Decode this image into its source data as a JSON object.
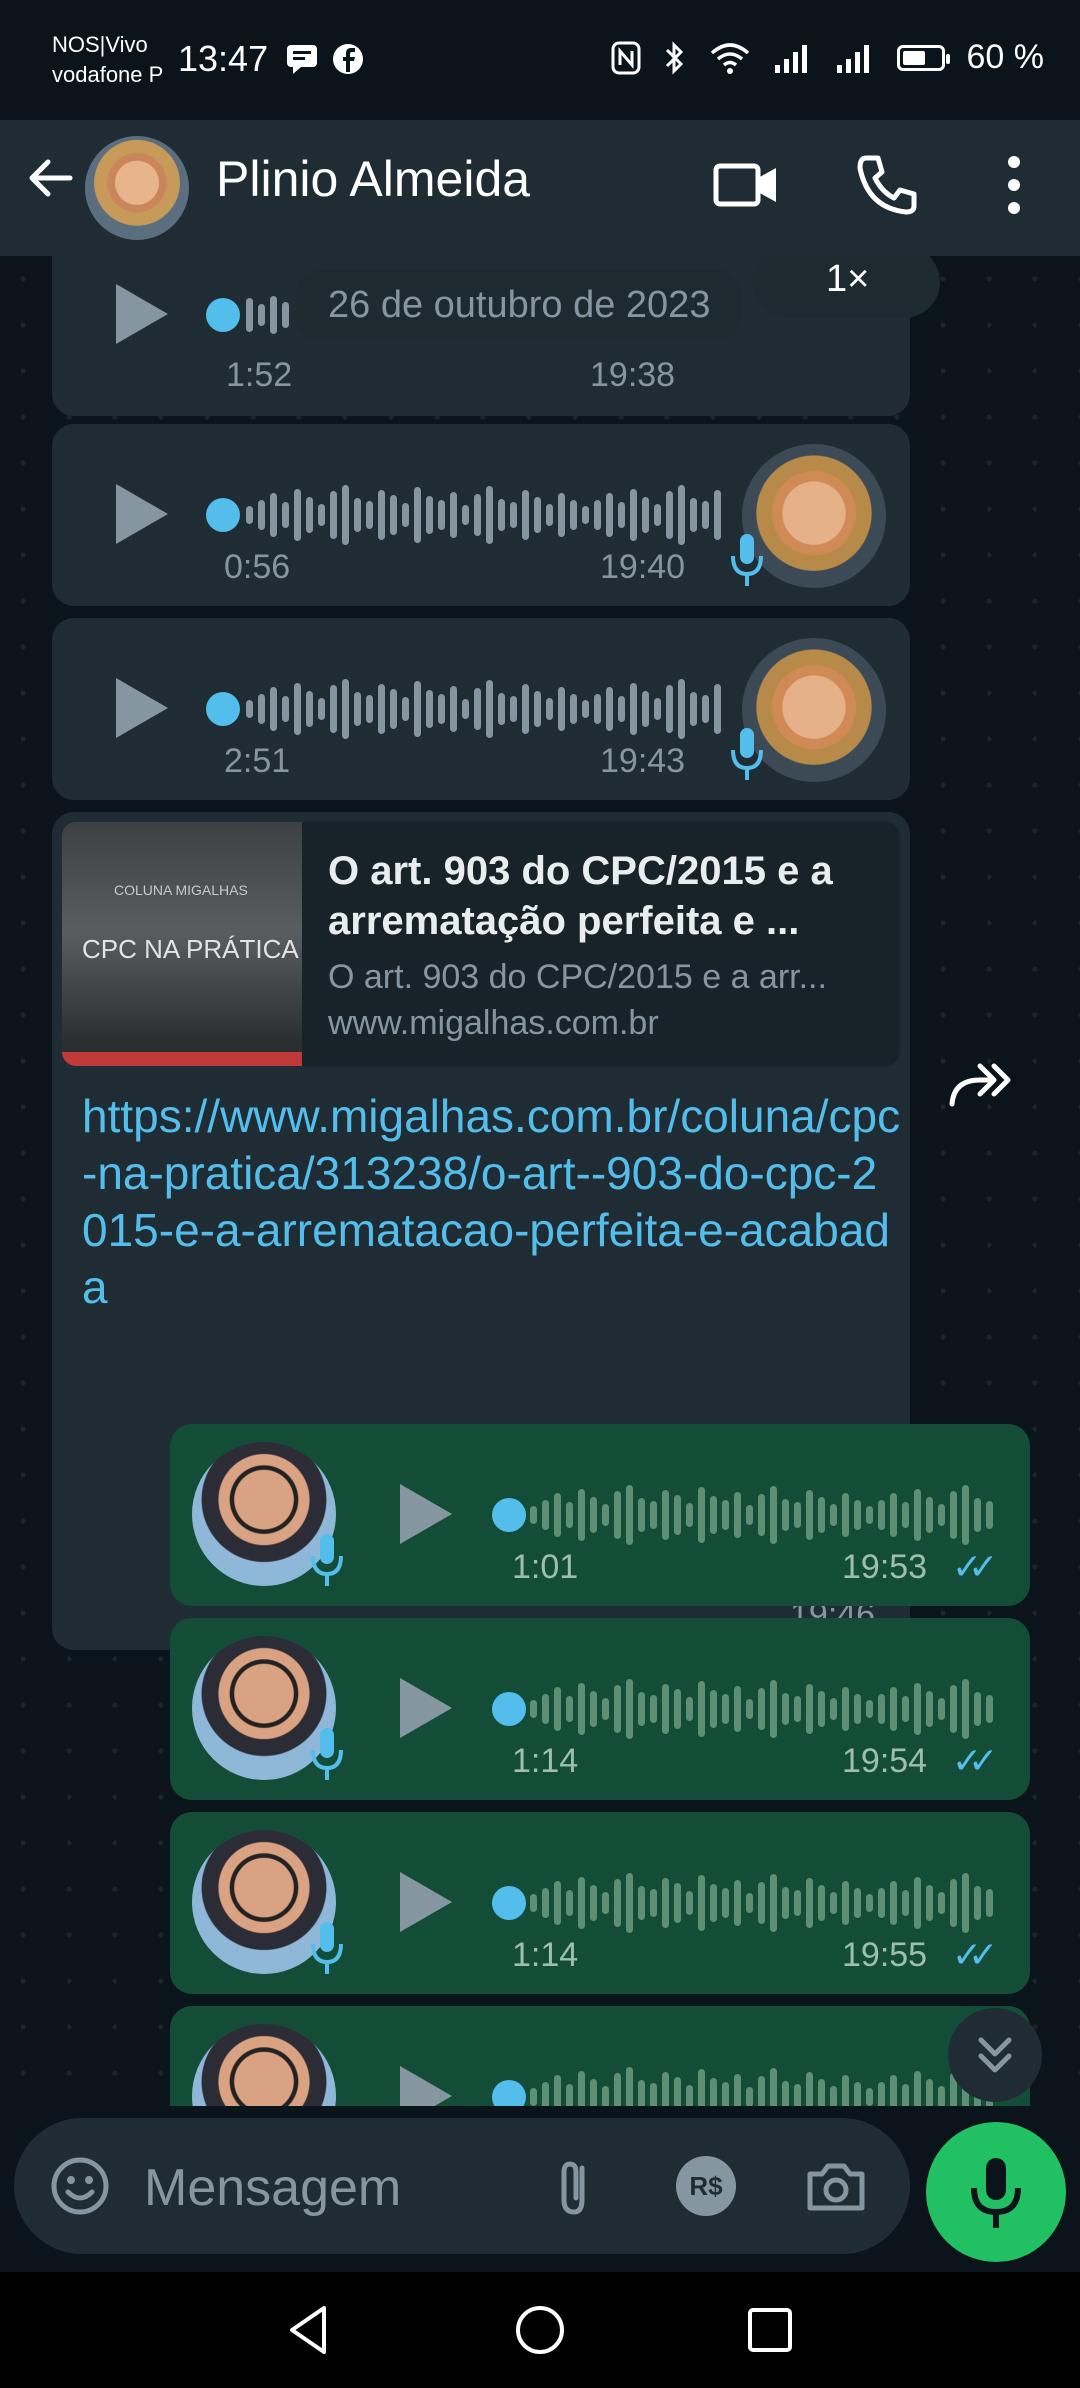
{
  "status_bar": {
    "carrier_1": "NOS|Vivo",
    "carrier_2": "vodafone P",
    "time": "13:47",
    "battery": "60 %",
    "battery_level": 0.6
  },
  "header": {
    "contact_name": "Plinio Almeida"
  },
  "chat": {
    "date_chip": "26 de outubro de 2023",
    "speed_label": "1×",
    "incoming_voice": [
      {
        "duration": "1:52",
        "time": "19:38"
      },
      {
        "duration": "0:56",
        "time": "19:40"
      },
      {
        "duration": "2:51",
        "time": "19:43"
      }
    ],
    "link_message": {
      "thumb_title_small": "COLUNA MIGALHAS",
      "thumb_title": "CPC NA PRÁTICA",
      "preview_title": "O art. 903 do CPC/2015 e a arrematação perfeita e ...",
      "preview_desc": "O art. 903 do CPC/2015 e a arr...",
      "preview_site": "www.migalhas.com.br",
      "url": "https://www.migalhas.com.br/coluna/cpc-na-pratica/313238/o-art--903-do-cpc-2015-e-a-arrematacao-perfeita-e-acabada",
      "time": "19:46"
    },
    "outgoing_voice": [
      {
        "duration": "1:01",
        "time": "19:53"
      },
      {
        "duration": "1:14",
        "time": "19:54"
      },
      {
        "duration": "1:14",
        "time": "19:55"
      }
    ],
    "read_ticks": "✓✓"
  },
  "input": {
    "placeholder": "Mensagem",
    "currency_label": "R$"
  },
  "colors": {
    "background": "#0b141a",
    "incoming_bubble": "#1f2c34",
    "outgoing_bubble": "#144d37",
    "accent_blue": "#53bdeb",
    "mic_green": "#21c063"
  }
}
